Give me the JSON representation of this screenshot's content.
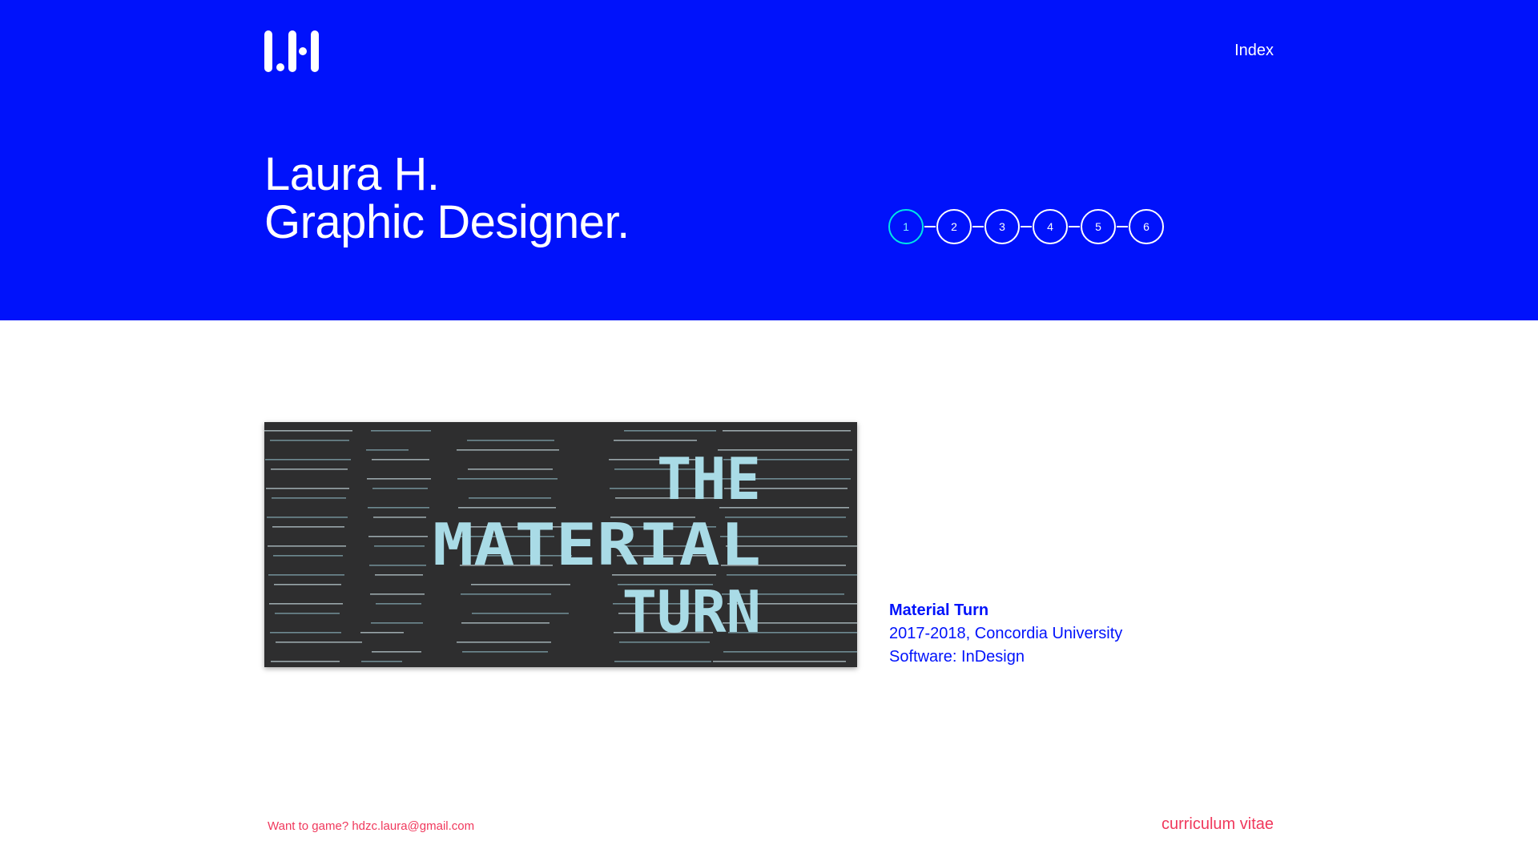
{
  "header": {
    "logo_text": "LH",
    "nav_link": "Index"
  },
  "hero": {
    "title_line1": "Laura H.",
    "title_line2": "Graphic Designer."
  },
  "stepper": {
    "steps": [
      "1",
      "2",
      "3",
      "4",
      "5",
      "6"
    ],
    "active": 1
  },
  "project": {
    "artwork_text": [
      "THE",
      "MATERIAL",
      "TURN"
    ],
    "name": "Material Turn",
    "date_place": "2017-2018, Concordia University",
    "software": "Software: InDesign"
  },
  "footer": {
    "contact": "Want to game? hdzc.laura@gmail.com",
    "cv_link": "curriculum vitae"
  },
  "colors": {
    "hero_bg": "#0012fb",
    "accent_text": "#0012fb",
    "footer_text": "#f0385c",
    "active_step": "#00e5e5",
    "artwork_bg": "#2e2e2f",
    "artwork_text": "#a9dbe6"
  }
}
